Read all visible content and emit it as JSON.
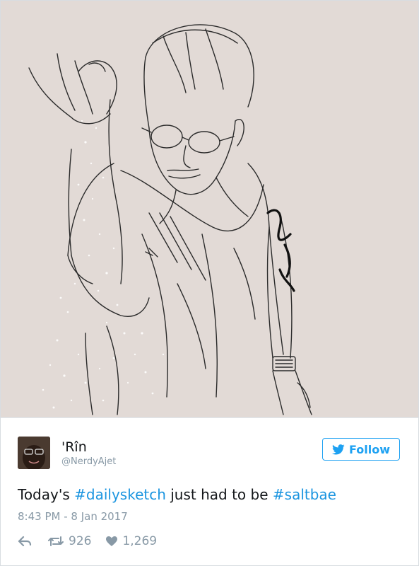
{
  "tweet": {
    "display_name": "'Rîn",
    "handle": "@NerdyAjet",
    "follow_label": "Follow",
    "text_parts": {
      "pre": "Today's ",
      "hashtag1": "#dailysketch",
      "mid": " just had to be ",
      "hashtag2": "#saltbae"
    },
    "timestamp": "8:43 PM - 8 Jan 2017",
    "retweet_count": "926",
    "like_count": "1,269"
  },
  "icons": {
    "follow": "bird-icon",
    "reply": "reply-icon",
    "retweet": "retweet-icon",
    "like": "heart-icon"
  },
  "colors": {
    "accent": "#1da1f2",
    "hashtag": "#1b95e0",
    "muted": "#8899a6",
    "media_bg": "#e2dad6"
  }
}
